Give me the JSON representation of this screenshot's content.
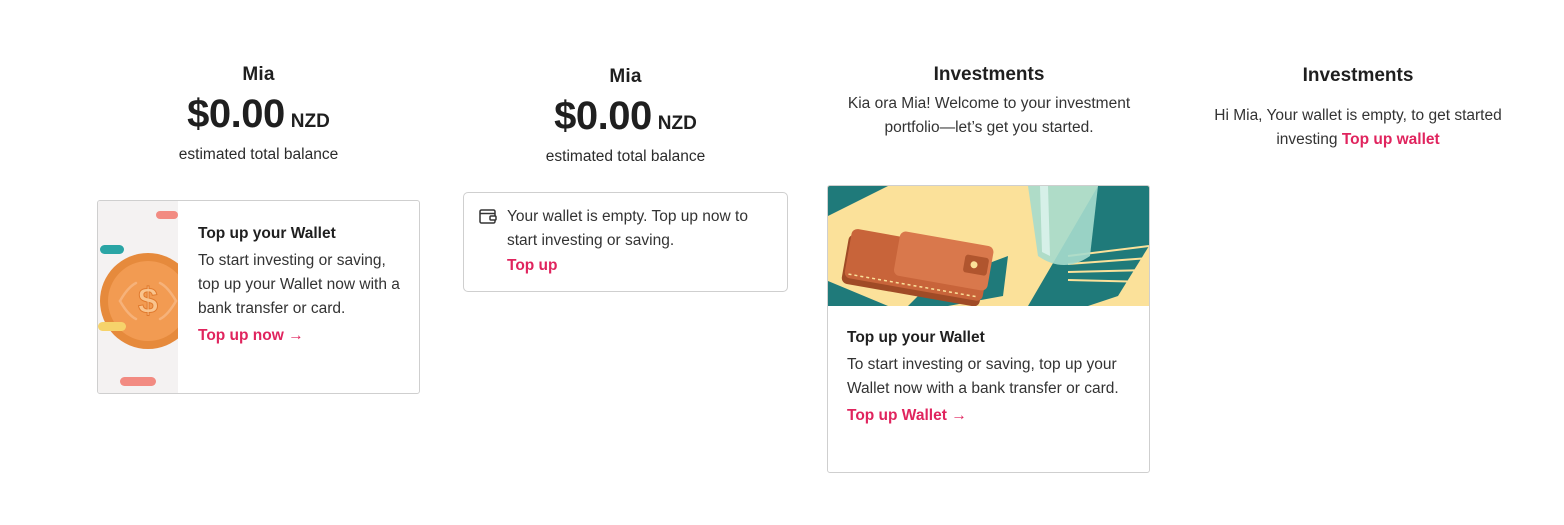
{
  "panel1": {
    "name": "Mia",
    "amount": "$0.00",
    "currency": "NZD",
    "subtitle": "estimated total balance",
    "card": {
      "title": "Top up your Wallet",
      "body": "To start investing or saving, top up your Wallet now with a bank transfer or card.",
      "link": "Top up now",
      "link_arrow": "→",
      "icon": "coin-icon"
    }
  },
  "panel2": {
    "name": "Mia",
    "amount": "$0.00",
    "currency": "NZD",
    "subtitle": "estimated total balance",
    "notice": {
      "icon": "wallet-icon",
      "text": "Your wallet is empty. Top up now to start investing or saving.",
      "link": "Top up"
    }
  },
  "panel3": {
    "title": "Investments",
    "description": "Kia ora Mia! Welcome to your investment portfolio—let’s get you started.",
    "card": {
      "title": "Top up your Wallet",
      "body": "To start investing or saving, top up your Wallet now with a bank transfer or card.",
      "link": "Top up Wallet",
      "link_arrow": "→"
    }
  },
  "panel4": {
    "title": "Investments",
    "message": "Hi Mia, Your wallet is empty, to get started investing",
    "link": "Top up wallet"
  },
  "colors": {
    "accent": "#e0245e",
    "border": "#cfcfcf",
    "illustration_bg": "#fbe19a",
    "illustration_teal": "#1f7a7a",
    "wallet_brown": "#c8643a",
    "coin_orange": "#f29b52"
  }
}
